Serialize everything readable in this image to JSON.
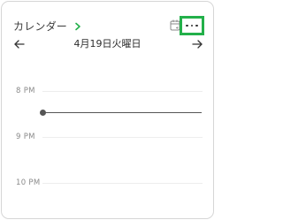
{
  "widget": {
    "title": "カレンダー",
    "title_chevron_icon": "chevron-right-icon",
    "title_chevron_color": "#23b04a",
    "calendar_icon": "calendar-icon",
    "more_icon": "more-horizontal-icon",
    "highlight_color": "#23b04a"
  },
  "navigation": {
    "prev_icon": "arrow-left-icon",
    "next_icon": "arrow-right-icon",
    "date": "4月19日火曜日"
  },
  "timeline": {
    "hours": [
      "8 PM",
      "9 PM",
      "10 PM"
    ],
    "current_time_indicator": "current-time-line"
  }
}
